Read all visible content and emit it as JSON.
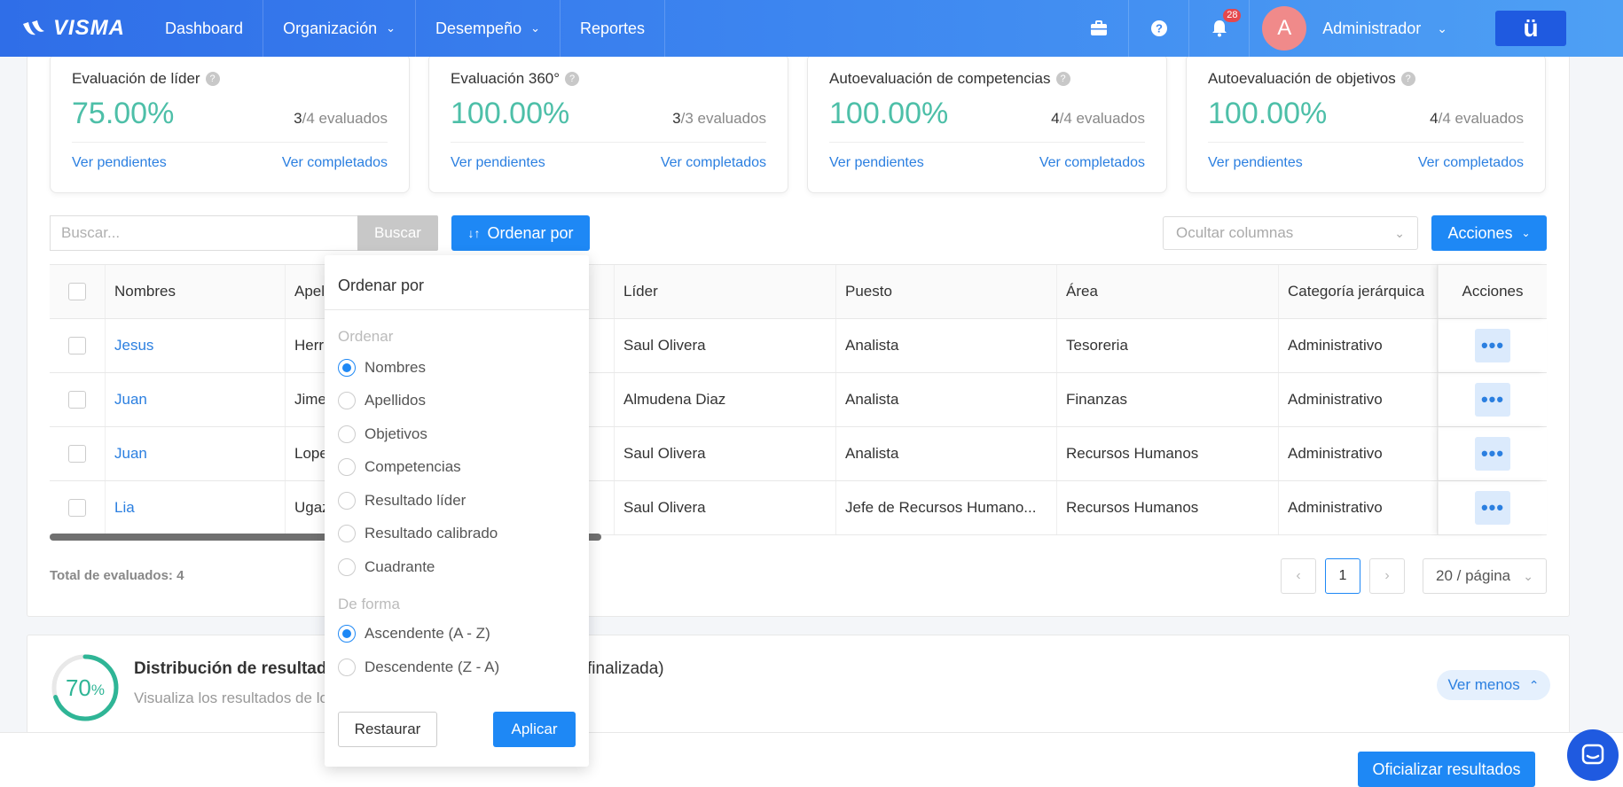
{
  "nav": {
    "logo": "VISMA",
    "items": [
      {
        "label": "Dashboard",
        "dropdown": false
      },
      {
        "label": "Organización",
        "dropdown": true
      },
      {
        "label": "Desempeño",
        "dropdown": true
      },
      {
        "label": "Reportes",
        "dropdown": false
      }
    ],
    "notifications_count": "28",
    "avatar_initial": "A",
    "user_name": "Administrador",
    "app_badge": "ü"
  },
  "stats": [
    {
      "title": "Evaluación de líder",
      "percent": "75.00%",
      "done": "3",
      "total_label": "/4 evaluados",
      "pending_link": "Ver pendientes",
      "completed_link": "Ver completados"
    },
    {
      "title": "Evaluación 360°",
      "percent": "100.00%",
      "done": "3",
      "total_label": "/3 evaluados",
      "pending_link": "Ver pendientes",
      "completed_link": "Ver completados"
    },
    {
      "title": "Autoevaluación de competencias",
      "percent": "100.00%",
      "done": "4",
      "total_label": "/4 evaluados",
      "pending_link": "Ver pendientes",
      "completed_link": "Ver completados"
    },
    {
      "title": "Autoevaluación de objetivos",
      "percent": "100.00%",
      "done": "4",
      "total_label": "/4 evaluados",
      "pending_link": "Ver pendientes",
      "completed_link": "Ver completados"
    }
  ],
  "toolbar": {
    "search_placeholder": "Buscar...",
    "search_button": "Buscar",
    "sort_button": "Ordenar por",
    "hide_columns_placeholder": "Ocultar columnas",
    "actions_button": "Acciones"
  },
  "table": {
    "headers": {
      "nombres": "Nombres",
      "apellidos": "Apel",
      "lider": "Líder",
      "puesto": "Puesto",
      "area": "Área",
      "categoria": "Categoría jerárquica",
      "acciones": "Acciones"
    },
    "rows": [
      {
        "nombre": "Jesus",
        "apellido": "Herr",
        "lider": "Saul Olivera",
        "puesto": "Analista",
        "area": "Tesoreria",
        "categoria": "Administrativo"
      },
      {
        "nombre": "Juan",
        "apellido": "Jime",
        "lider": "Almudena Diaz",
        "puesto": "Analista",
        "area": "Finanzas",
        "categoria": "Administrativo"
      },
      {
        "nombre": "Juan",
        "apellido": "Lope",
        "lider": "Saul Olivera",
        "puesto": "Analista",
        "area": "Recursos Humanos",
        "categoria": "Administrativo"
      },
      {
        "nombre": "Lia",
        "apellido": "Ugaz",
        "lider": "Saul Olivera",
        "puesto": "Jefe de Recursos Humano...",
        "area": "Recursos Humanos",
        "categoria": "Administrativo"
      }
    ],
    "row_action": "•••"
  },
  "pagination": {
    "total_label": "Total de evaluados: 4",
    "current_page": "1",
    "page_size": "20 / página"
  },
  "distribution": {
    "percent": "70",
    "percent_sign": "%",
    "progress_fraction": 0.7,
    "title": "Distribución de resultad",
    "title_tail": "finalizada)",
    "subtitle": "Visualiza los resultados de lo",
    "toggle_label": "Ver menos"
  },
  "sort_panel": {
    "title": "Ordenar por",
    "order_section": "Ordenar",
    "order_options": [
      "Nombres",
      "Apellidos",
      "Objetivos",
      "Competencias",
      "Resultado líder",
      "Resultado calibrado",
      "Cuadrante"
    ],
    "order_selected": 0,
    "direction_section": "De forma",
    "direction_options": [
      "Ascendente (A - Z)",
      "Descendente (Z - A)"
    ],
    "direction_selected": 0,
    "reset_button": "Restaurar",
    "apply_button": "Aplicar"
  },
  "footer": {
    "officialize_button": "Oficializar resultados"
  },
  "colors": {
    "primary": "#1e88f5",
    "nav_start": "#2f6ee8",
    "nav_end": "#4ea0f4",
    "stat_green": "#4dbfa8",
    "link_blue": "#2b7fe0",
    "badge_red": "#e5484d"
  }
}
